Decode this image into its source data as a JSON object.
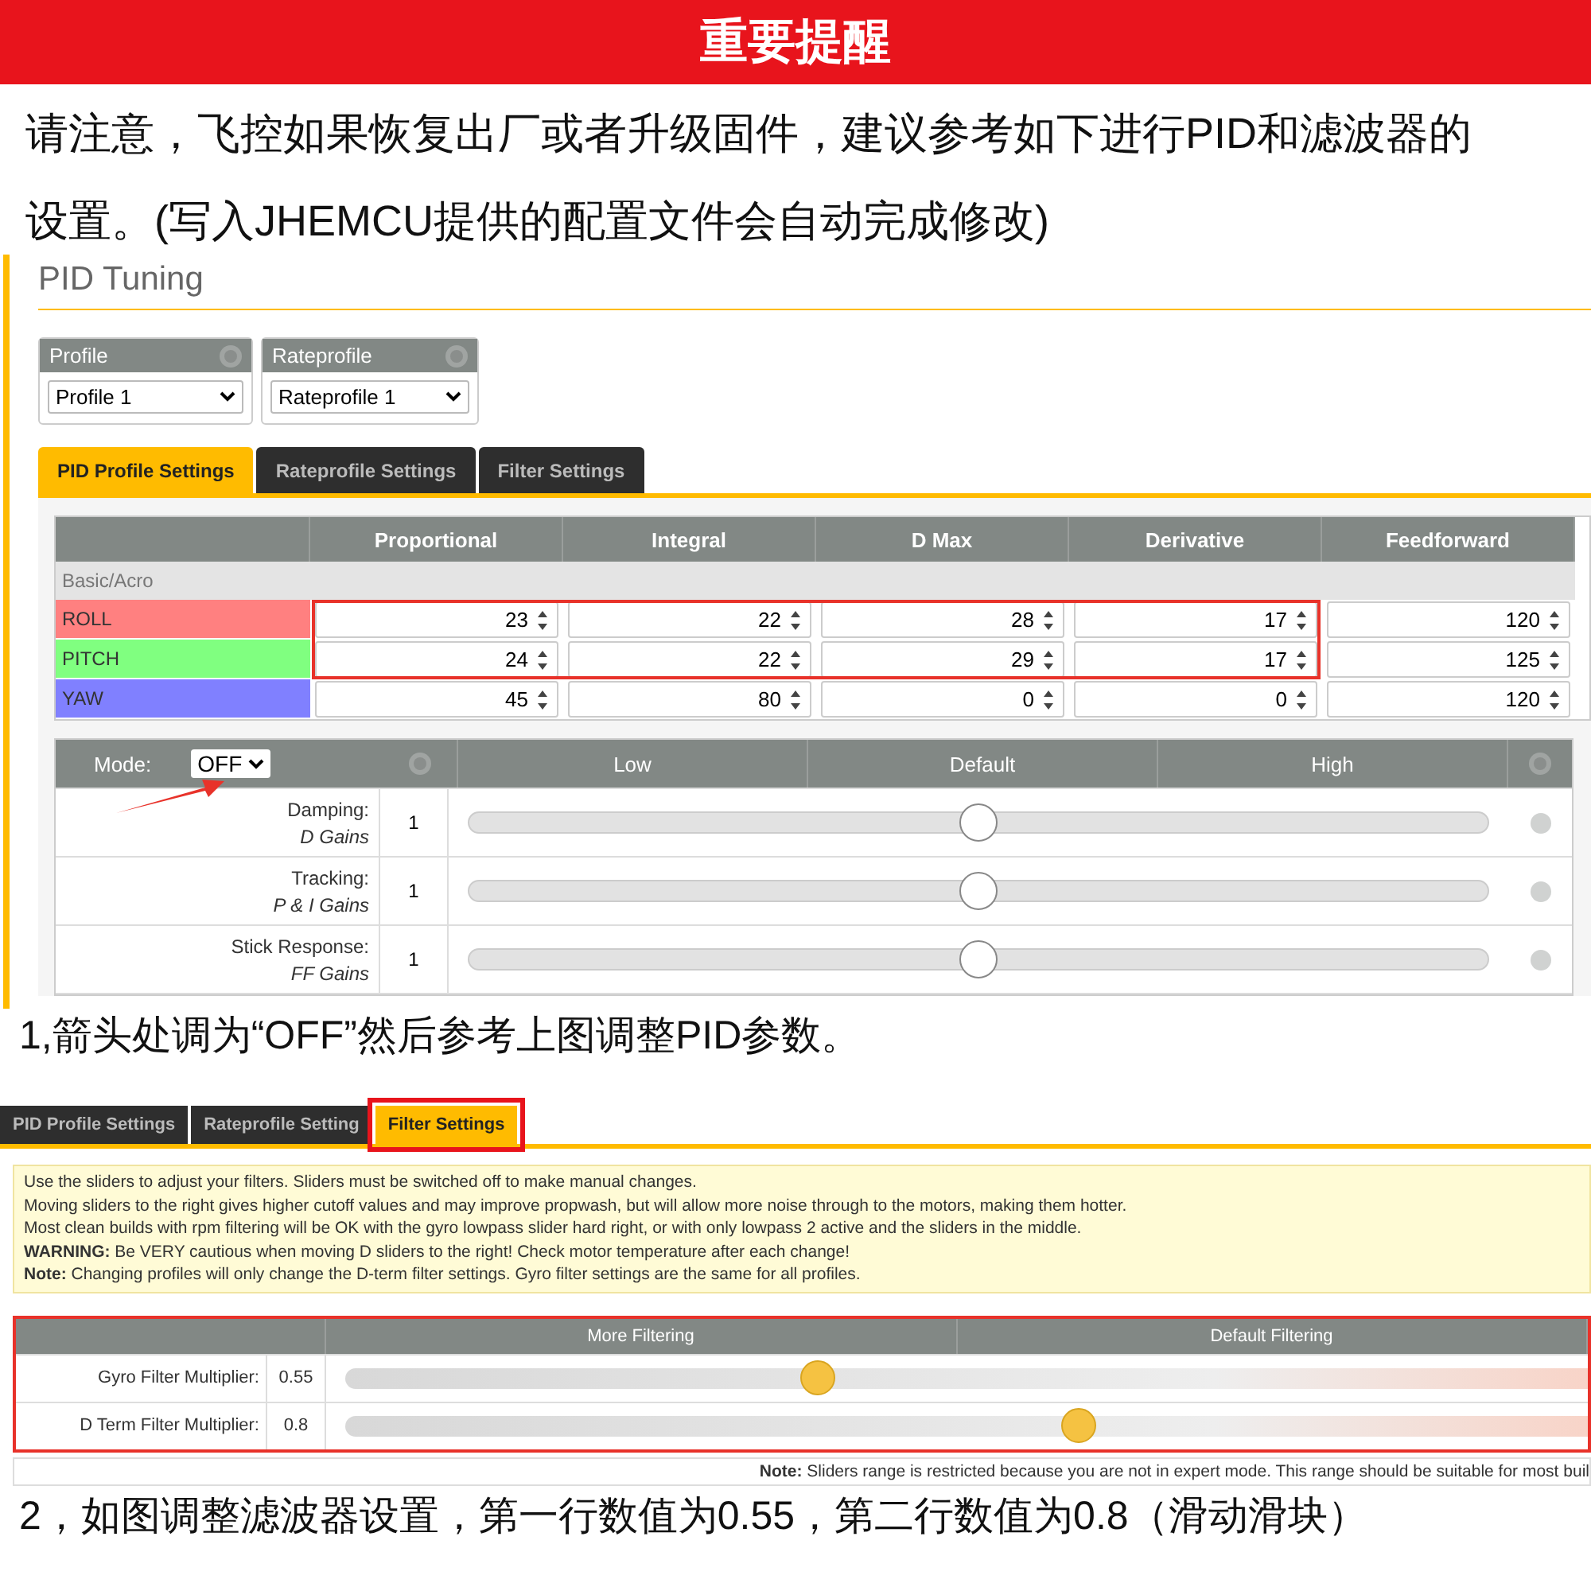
{
  "banner": {
    "title": "重要提醒"
  },
  "intro": "请注意，飞控如果恢复出厂或者升级固件，建议参考如下进行PID和滤波器的设置。(写入JHEMCU提供的配置文件会自动完成修改)",
  "pid_screen": {
    "title": "PID Tuning",
    "selectors": [
      {
        "label": "Profile",
        "value": "Profile 1"
      },
      {
        "label": "Rateprofile",
        "value": "Rateprofile 1"
      }
    ],
    "tabs": [
      {
        "label": "PID Profile Settings",
        "selected": true
      },
      {
        "label": "Rateprofile Settings",
        "selected": false
      },
      {
        "label": "Filter Settings",
        "selected": false
      }
    ],
    "columns": [
      "Proportional",
      "Integral",
      "D Max",
      "Derivative",
      "Feedforward"
    ],
    "section": "Basic/Acro",
    "rows": [
      {
        "axis": "ROLL",
        "color": "#ff8080",
        "values": [
          "23",
          "22",
          "28",
          "17",
          "120"
        ]
      },
      {
        "axis": "PITCH",
        "color": "#80ff80",
        "values": [
          "24",
          "22",
          "29",
          "17",
          "125"
        ]
      },
      {
        "axis": "YAW",
        "color": "#8080ff",
        "values": [
          "45",
          "80",
          "0",
          "0",
          "120"
        ]
      }
    ],
    "mode": {
      "label": "Mode:",
      "value": "OFF"
    },
    "slider_columns": [
      "Low",
      "Default",
      "High"
    ],
    "sliders": [
      {
        "label": "Damping:",
        "sublabel": "D Gains",
        "value": "1",
        "level": 0.5
      },
      {
        "label": "Tracking:",
        "sublabel": "P & I Gains",
        "value": "1",
        "level": 0.5
      },
      {
        "label": "Stick Response:",
        "sublabel": "FF Gains",
        "value": "1",
        "level": 0.5
      }
    ]
  },
  "step1": "1,箭头处调为“OFF”然后参考上图调整PID参数。",
  "filter_screen": {
    "tabs": [
      {
        "label": "PID Profile Settings",
        "selected": false
      },
      {
        "label": "Rateprofile Setting",
        "selected": false
      },
      {
        "label": "Filter Settings",
        "selected": true
      }
    ],
    "notes": [
      "Use the sliders to adjust your filters. Sliders must be switched off to make manual changes.",
      "Moving sliders to the right gives higher cutoff values and may improve propwash, but will allow more noise through to the motors, making them hotter.",
      "Most clean builds with rpm filtering will be OK with the gyro lowpass slider hard right, or with only lowpass 2 active and the sliders in the middle.",
      "**WARNING:** Be VERY cautious when moving D sliders to the right! Check motor temperature after each change!",
      "**Note:** Changing profiles will only change the D-term filter settings. Gyro filter settings are the same for all profiles."
    ],
    "slider_columns": [
      "More Filtering",
      "Default Filtering"
    ],
    "sliders": [
      {
        "label": "Gyro Filter Multiplier:",
        "value": "0.55",
        "level": 0.38
      },
      {
        "label": "D Term Filter Multiplier:",
        "value": "0.8",
        "level": 0.59
      }
    ],
    "footnote": "**Note:** Sliders range is restricted because you are not in expert mode. This range should be suitable for most buil"
  },
  "step2": "2，如图调整滤波器设置，第一行数值为0.55，第二行数值为0.8（滑动滑块）"
}
